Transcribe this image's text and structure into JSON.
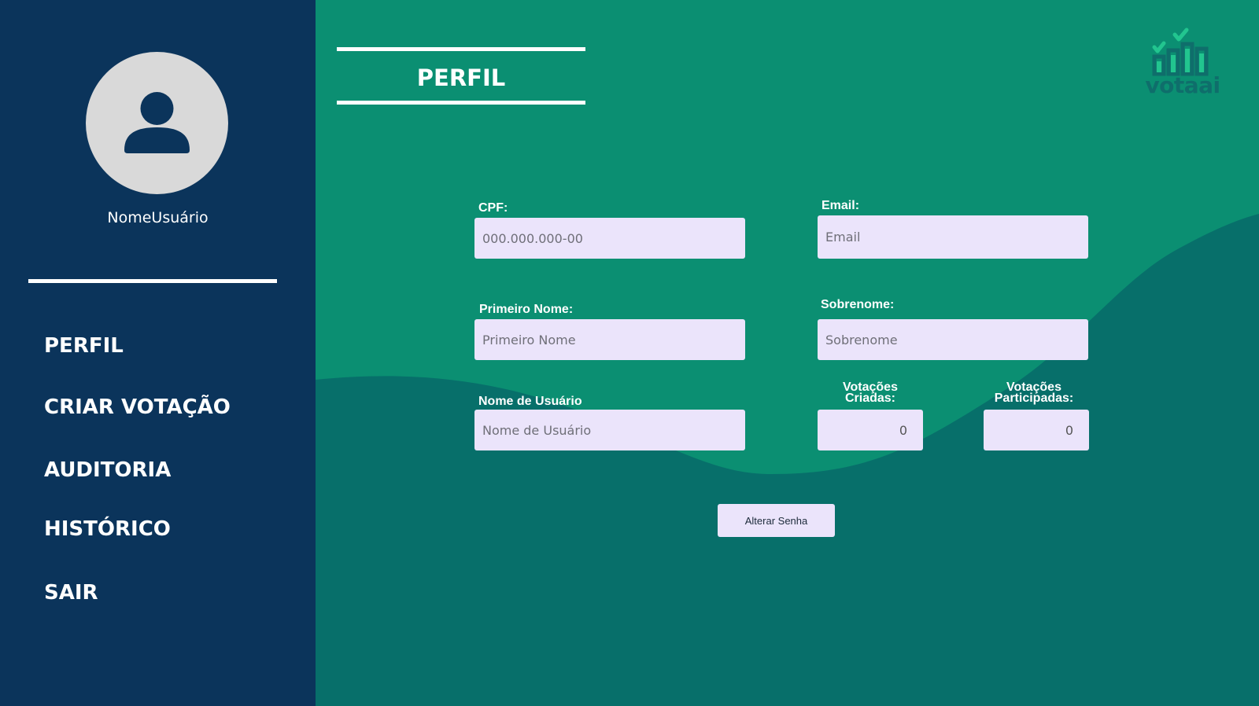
{
  "sidebar": {
    "username": "NomeUsuário",
    "items": [
      {
        "label": "PERFIL"
      },
      {
        "label": "CRIAR VOTAÇÃO"
      },
      {
        "label": "AUDITORIA"
      },
      {
        "label": "HISTÓRICO"
      },
      {
        "label": "SAIR"
      }
    ]
  },
  "header": {
    "title": "PERFIL",
    "logo_text": "votaai"
  },
  "form": {
    "cpf": {
      "label": "CPF:",
      "placeholder": "000.000.000-00"
    },
    "email": {
      "label": "Email:",
      "placeholder": "Email"
    },
    "first_name": {
      "label": "Primeiro Nome:",
      "placeholder": "Primeiro Nome"
    },
    "last_name": {
      "label": "Sobrenome:",
      "placeholder": "Sobrenome"
    },
    "username": {
      "label": "Nome de Usuário",
      "placeholder": "Nome de Usuário"
    },
    "votes_created": {
      "label_line1": "Votações",
      "label_line2": "Criadas:",
      "value": "0"
    },
    "votes_participated": {
      "label_line1": "Votações",
      "label_line2": "Participadas:",
      "value": "0"
    },
    "change_password_label": "Alterar Senha"
  },
  "colors": {
    "sidebar_bg": "#0b345b",
    "main_bg": "#0b8f72",
    "wave_bg": "#076f6a",
    "input_bg": "#ebe4fb",
    "logo_accent": "#22c58f"
  }
}
